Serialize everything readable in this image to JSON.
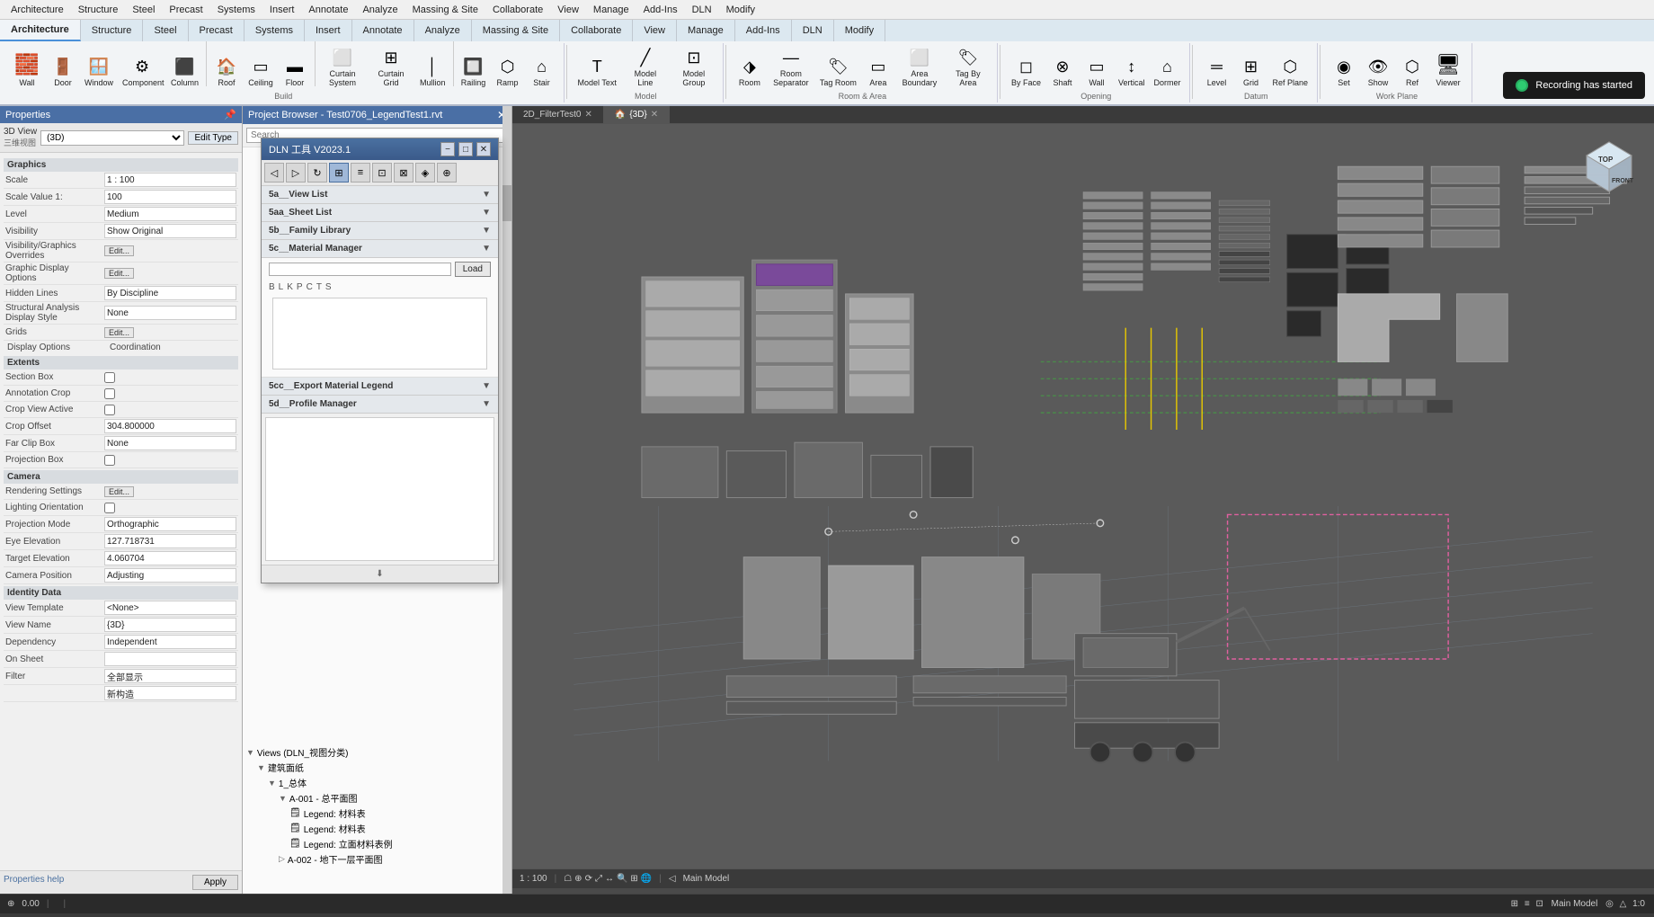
{
  "menu": {
    "items": [
      "Architecture",
      "Structure",
      "Steel",
      "Precast",
      "Systems",
      "Insert",
      "Annotate",
      "Analyze",
      "Massing & Site",
      "Collaborate",
      "View",
      "Manage",
      "Add-Ins",
      "DLN",
      "Modify"
    ]
  },
  "ribbon": {
    "tabs": [
      {
        "label": "Architecture",
        "active": true
      },
      {
        "label": "Structure",
        "active": false
      },
      {
        "label": "Steel",
        "active": false
      },
      {
        "label": "Precast",
        "active": false
      },
      {
        "label": "Systems",
        "active": false
      },
      {
        "label": "Insert",
        "active": false
      },
      {
        "label": "Annotate",
        "active": false
      },
      {
        "label": "Analyze",
        "active": false
      },
      {
        "label": "Massing & Site",
        "active": false
      },
      {
        "label": "Collaborate",
        "active": false
      },
      {
        "label": "View",
        "active": false
      },
      {
        "label": "Manage",
        "active": false
      },
      {
        "label": "Add-Ins",
        "active": false
      },
      {
        "label": "DLN",
        "active": false
      },
      {
        "label": "Modify",
        "active": false
      }
    ],
    "groups": {
      "build": {
        "label": "Build",
        "buttons": [
          "Wall",
          "Door",
          "Window",
          "Component",
          "Column",
          "Roof",
          "Ceiling",
          "Floor",
          "Curtain System",
          "Curtain Grid",
          "Mullion",
          "Railing",
          "Ramp",
          "Stair"
        ]
      },
      "model": {
        "label": "Model",
        "buttons": [
          "Model Text",
          "Model Line",
          "Model Group"
        ]
      },
      "room_area": {
        "label": "Room & Area",
        "buttons": [
          "Room",
          "Room Separator",
          "Tag Room",
          "Area",
          "Area Boundary",
          "Tag By Area"
        ]
      },
      "opening": {
        "label": "Opening",
        "buttons": [
          "By Face",
          "Shaft",
          "Wall",
          "Vertical",
          "Dormer"
        ]
      },
      "datum": {
        "label": "Datum",
        "buttons": [
          "Level",
          "Grid",
          "Ref Plane"
        ]
      },
      "work_plane": {
        "label": "Work Plane",
        "buttons": [
          "Set",
          "Show",
          "Ref",
          "Viewer"
        ]
      }
    }
  },
  "left_panel": {
    "title": "Properties",
    "view_type": "3D View",
    "view_label": "三维视图",
    "view_dropdown": "(3D)",
    "edit_type_btn": "Edit Type",
    "properties": {
      "scale": "1 : 100",
      "scale_value": "100",
      "level": "Medium",
      "visibility": "Show Original",
      "visibility_graphics": "Edit...",
      "graphic_display": "Edit...",
      "hidden_lines": "By Discipline",
      "analysis_style": "None",
      "grids": "Edit...",
      "section_box": "",
      "annotation_crop": "",
      "crop_active": "",
      "crop_offset": "304.800000",
      "far_clip_box": "None",
      "projection_box": "",
      "rendering_settings": "Edit...",
      "lighting_orientation": "",
      "projection_mode": "Orthographic",
      "view_orientation": "",
      "eye_elevation": "127.718731",
      "target_elevation": "4.060704",
      "camera_position": "Adjusting",
      "identity_data": "",
      "view_template": "<None>",
      "view_name": "{3D}",
      "dependency": "Independent",
      "on_sheet": "",
      "filter": "全部显示",
      "phase_filter": "新构造"
    },
    "apply_btn": "Apply",
    "help_link": "Properties help",
    "section_headers": [
      "Graphics",
      "Identity Data"
    ],
    "section_labels": [
      "Display Options",
      "Coordination"
    ]
  },
  "project_browser": {
    "title": "Project Browser - Test0706_LegendTest1.rvt",
    "search_placeholder": "Search",
    "tree": {
      "views_label": "Views (DLN_视图分类)",
      "view_5a": "5a__View List",
      "view_5aa": "5aa_Sheet List",
      "view_5b": "5b__Family Library",
      "view_5c": "5c__Material Manager",
      "view_5cc": "5cc__Export Material Legend",
      "view_5d": "5d__Profile Manager",
      "sheets_label": "建筑面纸",
      "sheet_1": "1_总体",
      "sheet_a001": "A-001 - 总平面图",
      "legend_1": "Legend: 材料表",
      "legend_2": "Legend: 材料表",
      "legend_3": "Legend: 立面材料表例",
      "sheet_a002": "A-002 - 地下一层平面图"
    }
  },
  "dln_dialog": {
    "title": "DLN 工具 V2023.1",
    "toolbar_icons": [
      "◁",
      "▷",
      "↻",
      "⊞",
      "≡",
      "⊡",
      "⊠",
      "◈",
      "⊕"
    ],
    "sections": {
      "view_list": "5a__View List",
      "sheet_list": "5aa_Sheet List",
      "family_library": "5b__Family Library",
      "material_manager": "5c__Material Manager",
      "material_input": "",
      "load_btn": "Load",
      "letters": [
        "B",
        "L",
        "K",
        "P",
        "C",
        "T",
        "S"
      ],
      "export_legend": "5cc__Export Material Legend",
      "profile_manager": "5d__Profile Manager"
    }
  },
  "viewport": {
    "tabs": [
      {
        "label": "2D_FilterTest0",
        "active": false,
        "closeable": true
      },
      {
        "label": "{3D}",
        "active": true,
        "closeable": true
      }
    ],
    "nav_cube": {
      "top": "TOP",
      "front": "FRONT"
    },
    "status": {
      "scale": "1 : 100",
      "model": "Main Model"
    }
  },
  "recording": {
    "text": "Recording has started"
  },
  "status_bar": {
    "items": [
      "⊕",
      "0.00",
      "Main Model",
      "◎"
    ]
  }
}
